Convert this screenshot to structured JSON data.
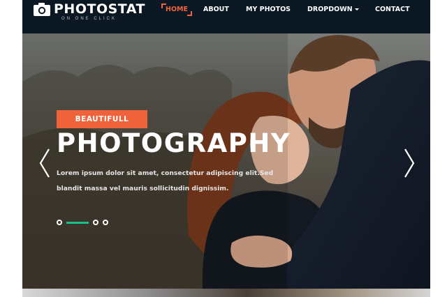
{
  "brand": {
    "name": "PHOTOSTAT",
    "tagline": "ON ONE CLICK",
    "logo_icon": "camera-icon"
  },
  "nav": {
    "items": [
      {
        "label": "HOME",
        "active": true
      },
      {
        "label": "ABOUT",
        "active": false
      },
      {
        "label": "MY PHOTOS",
        "active": false
      },
      {
        "label": "DROPDOWN",
        "active": false,
        "has_caret": true
      },
      {
        "label": "CONTACT",
        "active": false
      }
    ]
  },
  "hero": {
    "badge": "BEAUTIFULL",
    "headline": "PHOTOGRAPHY",
    "description": "Lorem ipsum dolor sit amet, consectetur adipiscing elit.Sed blandit massa vel mauris sollicitudin dignissim.",
    "prev_icon": "chevron-left-icon",
    "next_icon": "chevron-right-icon",
    "slides": {
      "count": 4,
      "active_index": 1
    }
  },
  "colors": {
    "header_bg": "#0b1824",
    "accent": "#f2653b",
    "indicator": "#1bbf8c",
    "text": "#ffffff"
  }
}
